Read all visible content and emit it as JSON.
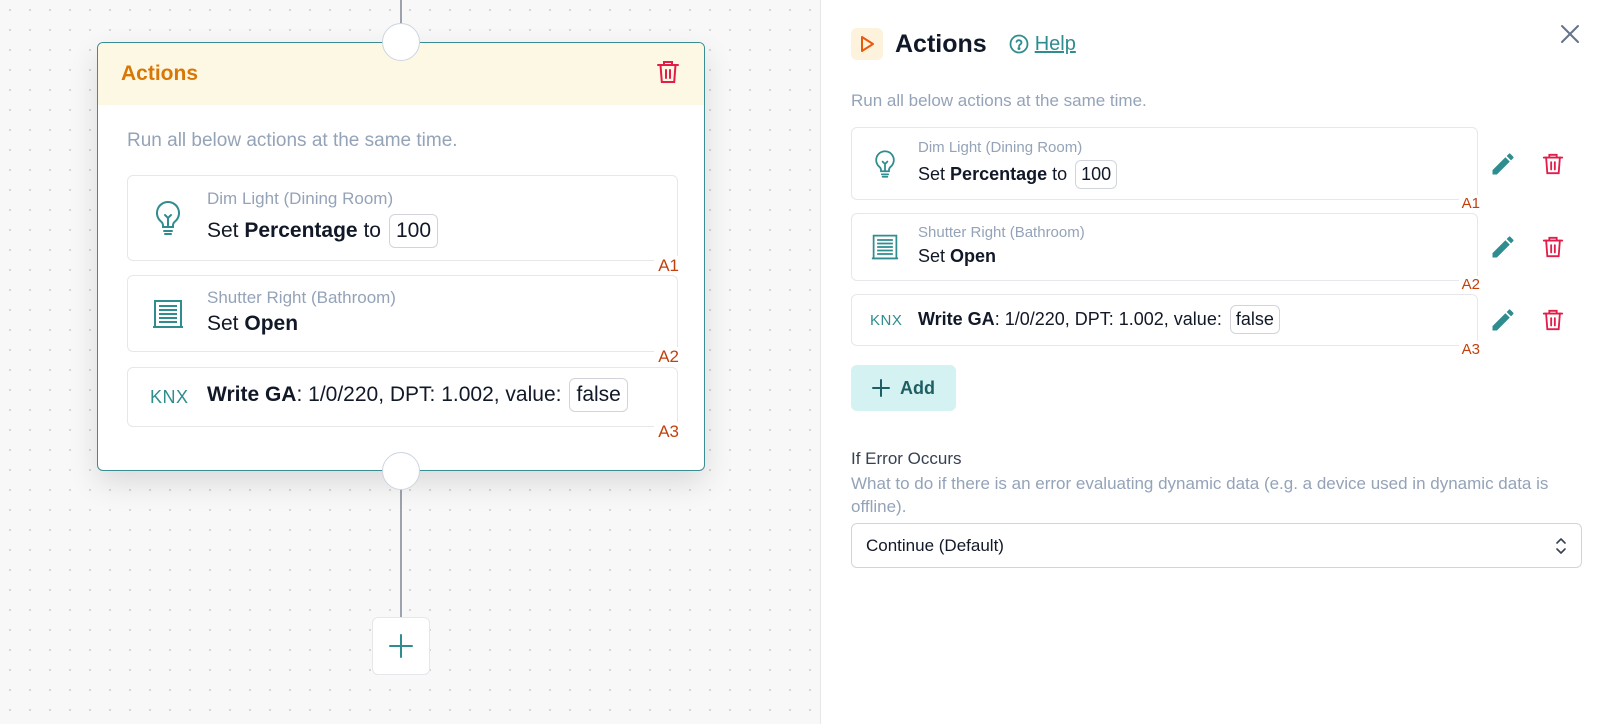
{
  "canvas": {
    "node": {
      "title": "Actions",
      "description": "Run all below actions at the same time.",
      "actions": [
        {
          "icon": "lightbulb-icon",
          "device": "Dim Light (Dining Room)",
          "prefix": "Set",
          "property": "Percentage",
          "connector": "to",
          "value": "100",
          "tag": "A1"
        },
        {
          "icon": "shutter-icon",
          "device": "Shutter Right (Bathroom)",
          "prefix": "Set",
          "property": "Open",
          "tag": "A2"
        },
        {
          "icon": "knx-icon",
          "icon_text": "KNX",
          "property": "Write GA",
          "detail": ": 1/0/220, DPT: 1.002, value:",
          "value": "false",
          "tag": "A3"
        }
      ]
    }
  },
  "panel": {
    "title": "Actions",
    "help_label": "Help",
    "description": "Run all below actions at the same time.",
    "add_label": "Add",
    "error": {
      "label": "If Error Occurs",
      "help": "What to do if there is an error evaluating dynamic data (e.g. a device used in dynamic data is offline).",
      "selected": "Continue (Default)"
    }
  },
  "colors": {
    "accent": "#2f8c8f",
    "orange": "#d97706",
    "tag": "#c2410c",
    "danger": "#e11d48"
  }
}
